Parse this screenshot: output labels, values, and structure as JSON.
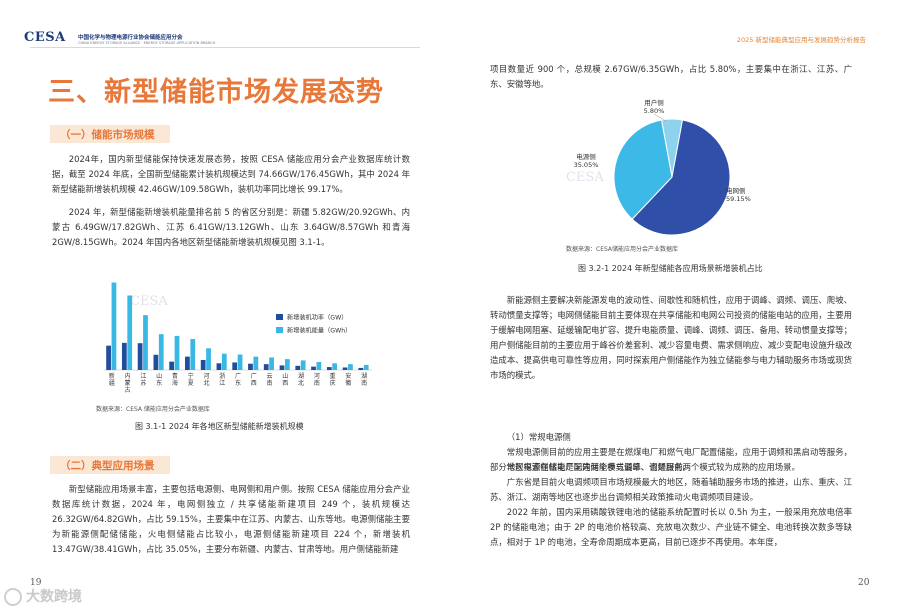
{
  "header": {
    "logo": "CESA",
    "org_name": "中国化学与物理电源行业协会储能应用分会",
    "org_sub": "CHINA ENERGY STORAGE ALLIANCE · ENERGY STORAGE APPLICATION BRANCH",
    "report_title": "2025 新型储能典型应用与发展趋势分析报告"
  },
  "left_page": {
    "section_title": "三、新型储能市场发展态势",
    "sub1": "（一）储能市场规模",
    "para1": "2024年，国内新型储能保持快速发展态势，按照 CESA 储能应用分会产业数据库统计数据，截至 2024 年底，全国新型储能累计装机规模达到 74.66GW/176.45GWh，其中 2024 年新型储能新增装机规模 42.46GW/109.58GWh，装机功率同比增长 99.17%。",
    "para2": "2024 年，新型储能新增装机能量排名前 5 的省区分别是：新疆 5.82GW/20.92GWh、内蒙古 6.49GW/17.82GWh、江苏 6.41GW/13.12GWh、山东 3.64GW/8.57GWh 和青海 2GW/8.15GWh。2024 年国内各地区新型储能新增装机规模见图 3.1-1。",
    "chart_source": "数据来源：CESA 储能应用分会产业数据库",
    "chart_caption": "图 3.1-1 2024 年各地区新型储能新增装机规模",
    "sub2": "（二）典型应用场景",
    "para3": "新型储能应用场景丰富，主要包括电源侧、电网侧和用户侧。按照 CESA 储能应用分会产业数据库统计数据，2024 年，电网侧独立 / 共享储能新建项目 249 个，装机规模达 26.32GW/64.82GWh，占比 59.15%，主要集中在江苏、内蒙古、山东等地。电源侧储能主要为新能源侧配储储能，火电侧储能占比较小，电源侧储能新建项目 224 个，新增装机 13.47GW/38.41GWh，占比 35.05%，主要分布新疆、内蒙古、甘肃等地。用户侧储能新建",
    "page_number": "19",
    "watermark": "大数跨境"
  },
  "right_page": {
    "para_top": "项目数量近 900 个，总规模 2.67GW/6.35GWh，占比 5.80%，主要集中在浙江、江苏、广东、安徽等地。",
    "pie_source": "数据来源：CESA储能应用分会产业数据库",
    "pie_caption": "图 3.2-1 2024 年新型储能各应用场景新增装机占比",
    "para_mid": "新能源侧主要解决新能源发电的波动性、间歇性和随机性，应用于调峰、调频、调压、爬坡、转动惯量支撑等；电网侧储能目前主要体现在共享储能和电网公司投资的储能电站的应用，主要用于缓解电网阻塞、延缓输配电扩容、提升电能质量、调峰、调频、调压、备用、转动惯量支撑等；用户侧储能目前的主要应用于峰谷价差套利、减少容量电费、需求侧响应、减少变配电设施升级改造成本、提高供电可靠性等应用，同时探索用户侧储能作为独立储能参与电力辅助服务市场或现货市场的模式。",
    "list_heading": "（1）常规电源侧",
    "para_a": "常规电源侧目前的应用主要是在燃煤电厂和燃气电厂配置储能，应用于调频和黑启动等服务，部分地区探索在核电厂配建储能参与调峰、调频服务。",
    "para_b": "常规电源侧储能是国内两个模式最早、也是目前两个模式较为成熟的应用场景。",
    "para_c": "广东省是目前火电调频项目市场规模最大的地区，随着辅助服务市场的推进，山东、重庆、江苏、浙江、湖南等地区也逐步出台调频相关政策推动火电调频项目建设。",
    "para_d": "2022 年前，国内采用磷酸铁锂电池的储能系统配置时长以 0.5h 为主，一般采用充放电倍率 2P 的储能电池；由于 2P 的电池价格较高、充放电次数少、产业链不健全、电池转换次数多等缺点，相对于 1P 的电池，全寿命周期成本更高，目前已逐步不再使用。本年度，",
    "page_number": "20"
  },
  "chart_data": [
    {
      "type": "bar",
      "categories": [
        "新疆",
        "内蒙古",
        "江苏",
        "山东",
        "青海",
        "宁夏",
        "河北",
        "浙江",
        "广东",
        "广西",
        "云南",
        "山西",
        "湖北",
        "河南",
        "重庆",
        "安徽",
        "湖南"
      ],
      "series": [
        {
          "name": "新增装机功率（GW）",
          "color": "#1f4e9c",
          "values": [
            5.82,
            6.49,
            6.41,
            3.64,
            2.0,
            3.2,
            2.4,
            1.6,
            1.8,
            1.5,
            1.4,
            1.1,
            1.0,
            0.8,
            0.7,
            0.6,
            0.5
          ]
        },
        {
          "name": "新增装机能量（GWh）",
          "color": "#39b8e6",
          "values": [
            20.92,
            17.82,
            13.12,
            8.57,
            8.15,
            7.4,
            5.2,
            3.9,
            3.7,
            3.2,
            3.0,
            2.6,
            2.3,
            1.9,
            1.6,
            1.4,
            1.2
          ]
        }
      ],
      "ylim": [
        0,
        22
      ]
    },
    {
      "type": "pie",
      "slices": [
        {
          "label": "电网侧",
          "value": 59.15,
          "display": "59.15%",
          "color": "#2f4fa8"
        },
        {
          "label": "电源侧",
          "value": 35.05,
          "display": "35.05%",
          "color": "#3db9e8"
        },
        {
          "label": "用户侧",
          "value": 5.8,
          "display": "5.80%",
          "color": "#8ed3ee"
        }
      ]
    }
  ]
}
